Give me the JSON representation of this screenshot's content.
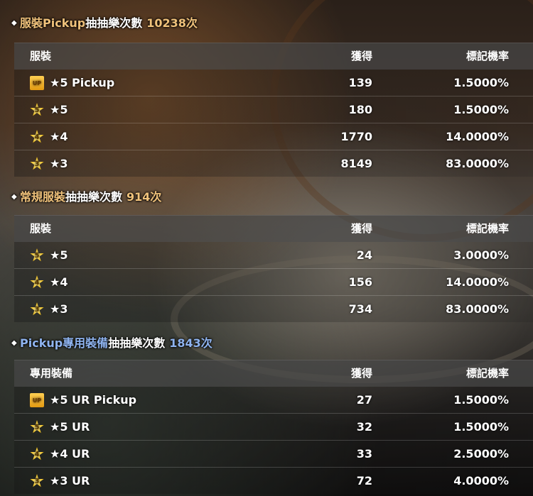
{
  "sections": [
    {
      "title_accent": "服裝Pickup",
      "title_rest": "抽抽樂次數",
      "count": "10238次",
      "headers": [
        "服裝",
        "獲得",
        "標記機率"
      ],
      "rows": [
        {
          "badge": "UP",
          "label": "★5 Pickup",
          "obtained": "139",
          "rate": "1.5000%"
        },
        {
          "badge": "5",
          "label": "★5",
          "obtained": "180",
          "rate": "1.5000%"
        },
        {
          "badge": "4",
          "label": "★4",
          "obtained": "1770",
          "rate": "14.0000%"
        },
        {
          "badge": "3",
          "label": "★3",
          "obtained": "8149",
          "rate": "83.0000%"
        }
      ]
    },
    {
      "title_accent": "常規服裝",
      "title_rest": "抽抽樂次數",
      "count": "914次",
      "headers": [
        "服裝",
        "獲得",
        "標記機率"
      ],
      "rows": [
        {
          "badge": "5",
          "label": "★5",
          "obtained": "24",
          "rate": "3.0000%"
        },
        {
          "badge": "4",
          "label": "★4",
          "obtained": "156",
          "rate": "14.0000%"
        },
        {
          "badge": "3",
          "label": "★3",
          "obtained": "734",
          "rate": "83.0000%"
        }
      ]
    },
    {
      "title_accent": "Pickup專用裝備",
      "title_rest": "抽抽樂次數",
      "count": "1843次",
      "headers": [
        "專用裝備",
        "獲得",
        "標記機率"
      ],
      "rows": [
        {
          "badge": "UP",
          "label": "★5 UR Pickup",
          "obtained": "27",
          "rate": "1.5000%"
        },
        {
          "badge": "5",
          "label": "★5 UR",
          "obtained": "32",
          "rate": "1.5000%"
        },
        {
          "badge": "4",
          "label": "★4 UR",
          "obtained": "33",
          "rate": "2.5000%"
        },
        {
          "badge": "3",
          "label": "★3 UR",
          "obtained": "72",
          "rate": "4.0000%"
        }
      ]
    }
  ],
  "colors": {
    "accent_gold": "#f0c27b",
    "accent_blue": "#8fb4f0"
  }
}
